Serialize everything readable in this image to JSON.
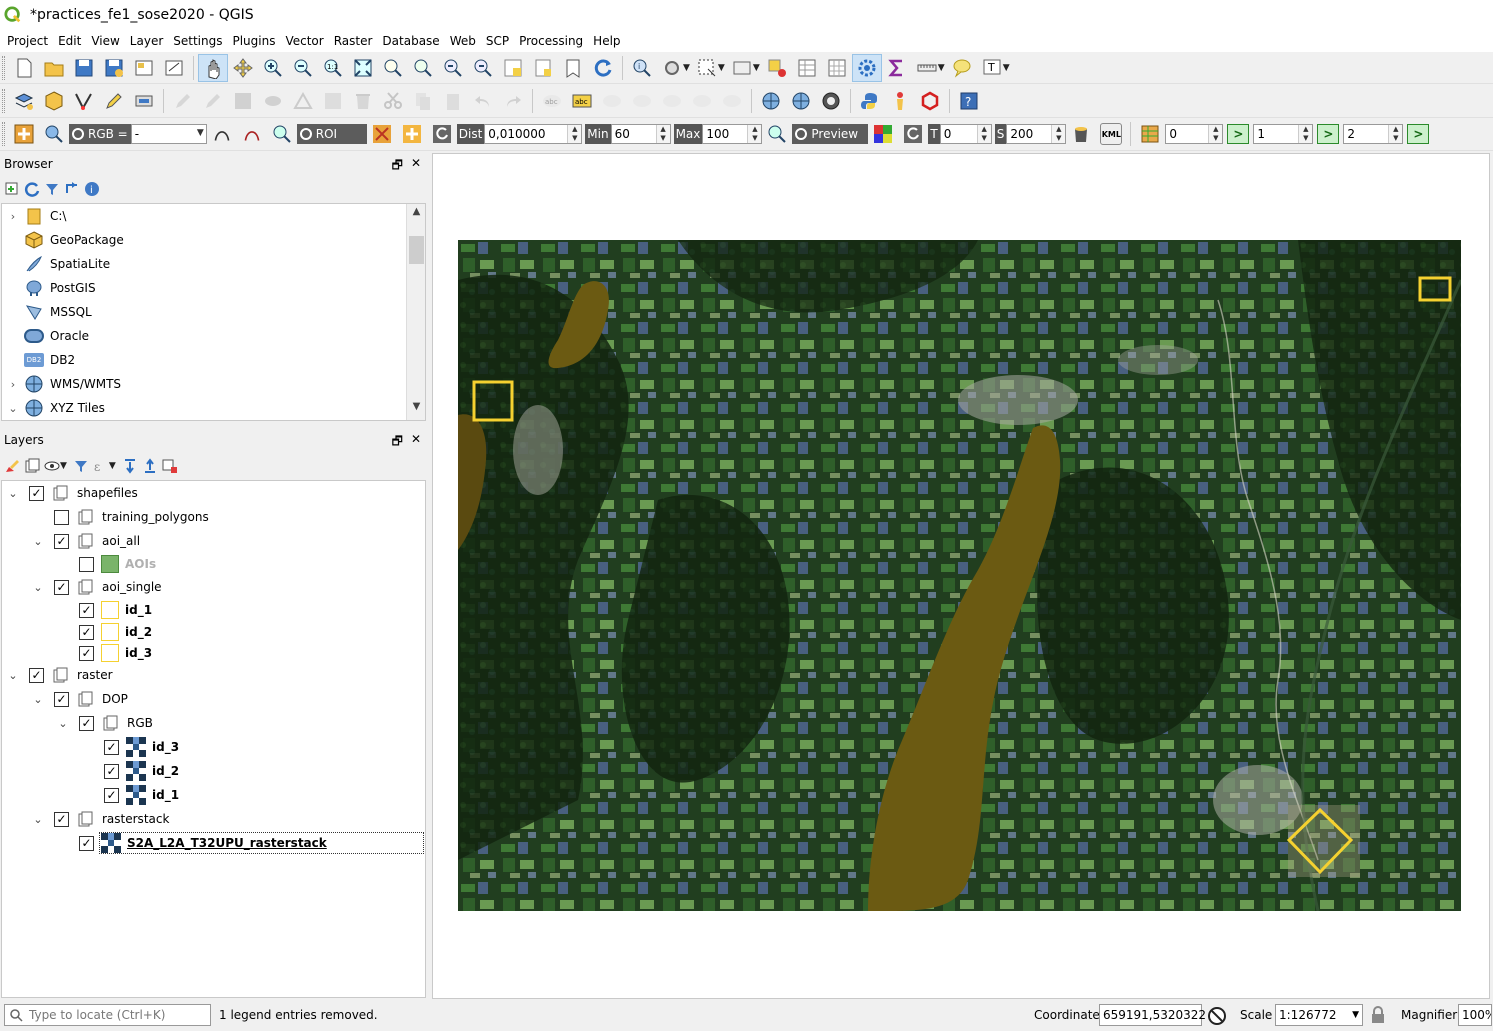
{
  "window": {
    "title": "*practices_fe1_sose2020 - QGIS"
  },
  "menu": [
    "Project",
    "Edit",
    "View",
    "Layer",
    "Settings",
    "Plugins",
    "Vector",
    "Raster",
    "Database",
    "Web",
    "SCP",
    "Processing",
    "Help"
  ],
  "scp_toolbar": {
    "rgb_label": "RGB =",
    "rgb_value": "-",
    "roi_label": "ROI",
    "dist_label": "Dist",
    "dist_value": "0,010000",
    "min_label": "Min",
    "min_value": "60",
    "max_label": "Max",
    "max_value": "100",
    "preview_label": "Preview",
    "t_label": "T",
    "t_value": "0",
    "s_label": "S",
    "s_value": "200",
    "kml_label": "KML",
    "band_value_1": "0",
    "band_value_2": "1",
    "band_value_3": "2"
  },
  "browser": {
    "title": "Browser",
    "items": [
      {
        "label": "C:\\",
        "icon": "folder-icon",
        "expandable": true
      },
      {
        "label": "GeoPackage",
        "icon": "geopackage-icon",
        "expandable": false
      },
      {
        "label": "SpatiaLite",
        "icon": "spatialite-icon",
        "expandable": false
      },
      {
        "label": "PostGIS",
        "icon": "postgis-icon",
        "expandable": false
      },
      {
        "label": "MSSQL",
        "icon": "mssql-icon",
        "expandable": false
      },
      {
        "label": "Oracle",
        "icon": "oracle-icon",
        "expandable": false
      },
      {
        "label": "DB2",
        "icon": "db2-icon",
        "expandable": false
      },
      {
        "label": "WMS/WMTS",
        "icon": "globe-icon",
        "expandable": true
      },
      {
        "label": "XYZ Tiles",
        "icon": "globe-icon",
        "expandable": true,
        "expanded": true
      }
    ],
    "db2_icon_text": "DB2"
  },
  "layers": {
    "title": "Layers",
    "rows": [
      {
        "label": "shapefiles",
        "type": "group",
        "checked": true
      },
      {
        "label": "training_polygons",
        "type": "group",
        "checked": false
      },
      {
        "label": "aoi_all",
        "type": "group",
        "checked": true
      },
      {
        "label": "AOIs",
        "type": "vector-fill",
        "checked": false
      },
      {
        "label": "aoi_single",
        "type": "group",
        "checked": true
      },
      {
        "label": "id_1",
        "type": "vector-outline",
        "checked": true
      },
      {
        "label": "id_2",
        "type": "vector-outline",
        "checked": true
      },
      {
        "label": "id_3",
        "type": "vector-outline",
        "checked": true
      },
      {
        "label": "raster",
        "type": "group",
        "checked": true
      },
      {
        "label": "DOP",
        "type": "group",
        "checked": true
      },
      {
        "label": "RGB",
        "type": "group",
        "checked": true
      },
      {
        "label": "id_3",
        "type": "raster",
        "checked": true
      },
      {
        "label": "id_2",
        "type": "raster",
        "checked": true
      },
      {
        "label": "id_1",
        "type": "raster",
        "checked": true
      },
      {
        "label": "rasterstack",
        "type": "group",
        "checked": true
      },
      {
        "label": "S2A_L2A_T32UPU_rasterstack",
        "type": "raster",
        "checked": true
      }
    ]
  },
  "statusbar": {
    "locator_placeholder": "Type to locate (Ctrl+K)",
    "message": "1 legend entries removed.",
    "coordinate_label": "Coordinate",
    "coordinate_value": "659191,5320322",
    "scale_label": "Scale",
    "scale_value": "1:126772",
    "magnifier_label": "Magnifier",
    "magnifier_value": "100%"
  },
  "colors": {
    "aoi_outline": "#f5d130",
    "aoi_fill": "#7ab46a",
    "lake": "#6b5a12",
    "forest": "#12240f"
  }
}
